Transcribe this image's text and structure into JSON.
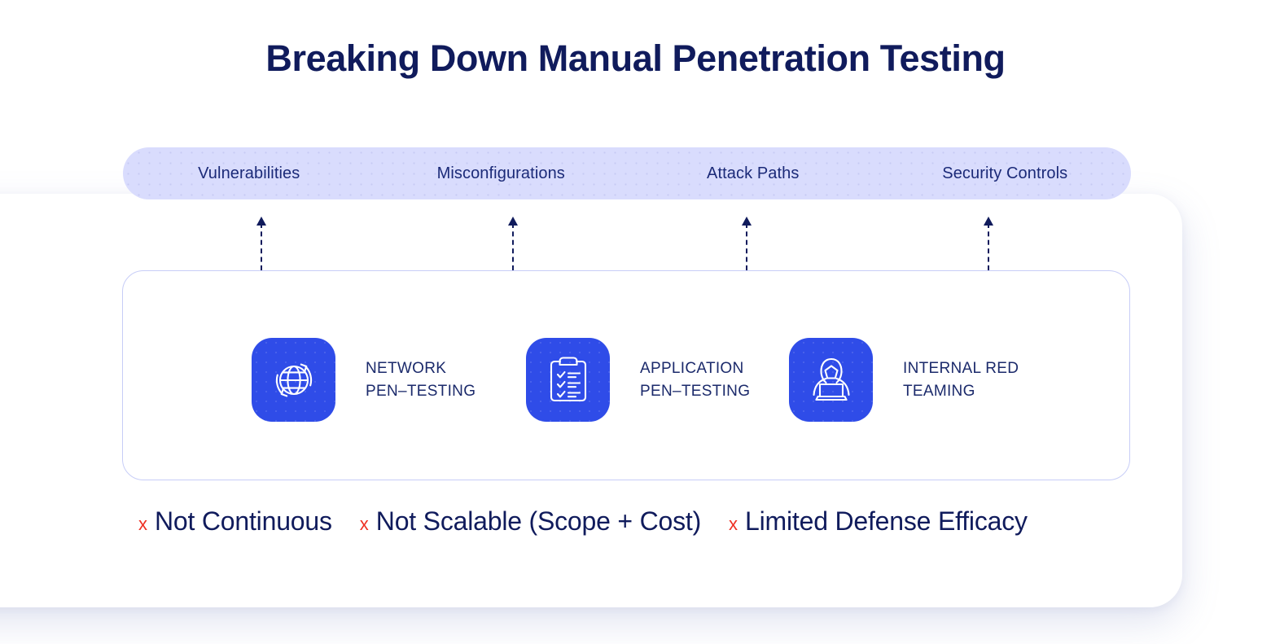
{
  "page": {
    "title": "Breaking Down Manual Penetration Testing",
    "colors": {
      "title_navy": "#101B5C",
      "banner_bg": "#D9DCFD",
      "banner_text": "#1B2A78",
      "tile_blue": "#2F4CE8",
      "panel_border": "#C7CDF7",
      "x_red": "#EE3124",
      "label_navy": "#1B2A6B",
      "background": "#FFFFFF"
    }
  },
  "banner": {
    "items": [
      {
        "label": "Vulnerabilities"
      },
      {
        "label": "Misconfigurations"
      },
      {
        "label": "Attack Paths"
      },
      {
        "label": "Security Controls"
      }
    ]
  },
  "arrows": [
    {
      "name": "arrow-to-vulnerabilities",
      "direction": "up",
      "style": "dashed"
    },
    {
      "name": "arrow-to-misconfigurations",
      "direction": "up",
      "style": "dashed"
    },
    {
      "name": "arrow-to-attack-paths",
      "direction": "up",
      "style": "dashed"
    },
    {
      "name": "arrow-to-security-controls",
      "direction": "up",
      "style": "dashed"
    }
  ],
  "services": [
    {
      "icon": "globe-refresh-icon",
      "line1": "NETWORK",
      "line2": "PEN–TESTING",
      "label": "NETWORK\nPEN–TESTING"
    },
    {
      "icon": "clipboard-checklist-icon",
      "line1": "APPLICATION",
      "line2": "PEN–TESTING",
      "label": "APPLICATION\nPEN–TESTING"
    },
    {
      "icon": "hooded-hacker-laptop-icon",
      "line1": "INTERNAL RED",
      "line2": "TEAMING",
      "label": "INTERNAL RED\nTEAMING"
    }
  ],
  "cons": {
    "marker": "x",
    "items": [
      {
        "label": "Not Continuous"
      },
      {
        "label": "Not Scalable (Scope + Cost)"
      },
      {
        "label": "Limited Defense Efficacy"
      }
    ]
  }
}
